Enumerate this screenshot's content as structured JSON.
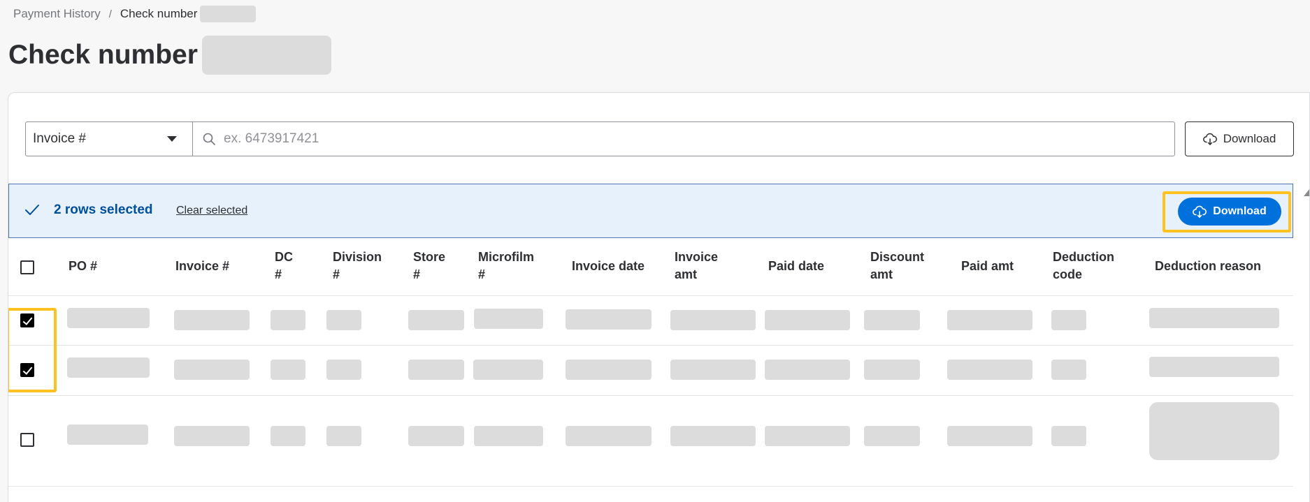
{
  "breadcrumb": {
    "parent": "Payment History",
    "separator": "/",
    "current": "Check number"
  },
  "page": {
    "title": "Check number"
  },
  "filter": {
    "selected": "Invoice #",
    "search_placeholder": "ex. 6473917421",
    "download_label": "Download"
  },
  "selection": {
    "count_label": "2 rows selected",
    "clear_label": "Clear selected",
    "download_label": "Download"
  },
  "table": {
    "columns": [
      {
        "line1": "PO #",
        "line2": ""
      },
      {
        "line1": "Invoice #",
        "line2": ""
      },
      {
        "line1": "DC",
        "line2": "#"
      },
      {
        "line1": "Division",
        "line2": "#"
      },
      {
        "line1": "Store",
        "line2": "#"
      },
      {
        "line1": "Microfilm",
        "line2": "#"
      },
      {
        "line1": "Invoice date",
        "line2": ""
      },
      {
        "line1": "Invoice",
        "line2": "amt"
      },
      {
        "line1": "Paid date",
        "line2": ""
      },
      {
        "line1": "Discount",
        "line2": "amt"
      },
      {
        "line1": "Paid amt",
        "line2": ""
      },
      {
        "line1": "Deduction",
        "line2": "code"
      },
      {
        "line1": "Deduction reason",
        "line2": ""
      }
    ],
    "rows": [
      {
        "selected": true
      },
      {
        "selected": true
      },
      {
        "selected": false
      }
    ]
  },
  "colors": {
    "primary": "#0071dc",
    "highlight": "#ffc220",
    "selection_bg": "#e6f1fc",
    "selection_text": "#004f9a"
  }
}
